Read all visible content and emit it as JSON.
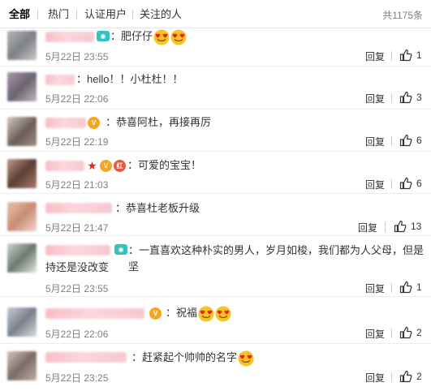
{
  "tabs": [
    {
      "label": "全部"
    },
    {
      "label": "热门"
    },
    {
      "label": "认证用户"
    },
    {
      "label": "关注的人"
    }
  ],
  "total_count": "共1175条",
  "heart_color": "#e8231d",
  "comments": [
    {
      "text": "：肥仔仔",
      "emoji": [
        "heart-eyes",
        "heart-eyes"
      ],
      "time": "5月22日 23:55",
      "reply": "回复",
      "likes": "1"
    },
    {
      "text": "：hello！！小杜杜！！",
      "emoji": [],
      "time": "5月22日 22:06",
      "reply": "回复",
      "likes": "3"
    },
    {
      "text": "：恭喜阿杜，再接再厉",
      "emoji": [],
      "time": "5月22日 22:19",
      "reply": "回复",
      "likes": "6"
    },
    {
      "text": "：可爱的宝宝！",
      "emoji": [],
      "time": "5月22日 21:03",
      "reply": "回复",
      "likes": "6"
    },
    {
      "text": "：恭喜杜老板升级",
      "emoji": [],
      "time": "5月22日 21:47",
      "reply": "回复",
      "likes": "13"
    },
    {
      "text": "：一直喜欢这种朴实的男人，岁月如梭，我们都为人父母，但是坚",
      "text2": "持还是没改变",
      "emoji": [],
      "time": "5月22日 23:55",
      "reply": "回复",
      "likes": "1"
    },
    {
      "text": "：祝福",
      "emoji": [
        "heart-eyes",
        "heart-eyes"
      ],
      "time": "5月22日 22:06",
      "reply": "回复",
      "likes": "2"
    },
    {
      "text": "：赶紧起个帅帅的名字",
      "emoji": [
        "heart-eyes"
      ],
      "time": "5月22日 23:25",
      "reply": "回复",
      "likes": "2"
    }
  ]
}
